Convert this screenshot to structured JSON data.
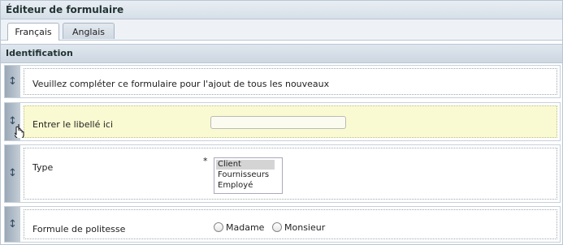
{
  "window": {
    "title": "Éditeur de formulaire"
  },
  "tabs": [
    {
      "label": "Français",
      "active": true
    },
    {
      "label": "Anglais",
      "active": false
    }
  ],
  "section": {
    "title": "Identification"
  },
  "rows": {
    "intro": {
      "text": "Veuillez compléter ce formulaire pour l'ajout de tous les nouveaux"
    },
    "label_field": {
      "label": "Entrer le libellé ici",
      "value": "",
      "placeholder": ""
    },
    "type_field": {
      "label": "Type",
      "required_marker": "*",
      "options": [
        "Client",
        "Fournisseurs",
        "Employé"
      ],
      "selected": "Client"
    },
    "salutation": {
      "label": "Formule de politesse",
      "options": [
        "Madame",
        "Monsieur"
      ]
    }
  },
  "icons": {
    "drag_handle": "drag-handle-icon",
    "hand_cursor": "hand-cursor-icon"
  },
  "colors": {
    "highlight_row": "#fafad2",
    "handle": "#9aa8b6",
    "selected_option": "#d4d4d4"
  }
}
